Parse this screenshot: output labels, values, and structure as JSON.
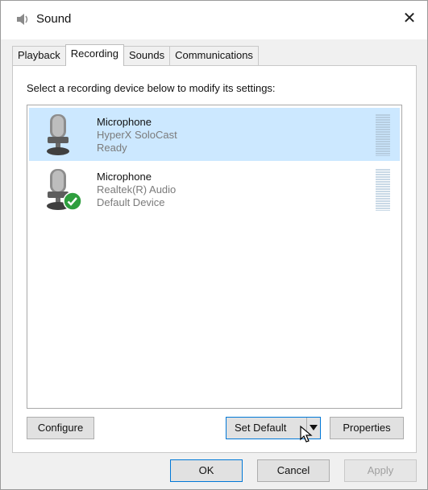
{
  "window": {
    "title": "Sound",
    "close_glyph": "✕"
  },
  "tabs": [
    {
      "label": "Playback",
      "active": false
    },
    {
      "label": "Recording",
      "active": true
    },
    {
      "label": "Sounds",
      "active": false
    },
    {
      "label": "Communications",
      "active": false
    }
  ],
  "recording": {
    "instruction": "Select a recording device below to modify its settings:",
    "devices": [
      {
        "name": "Microphone",
        "driver": "HyperX SoloCast",
        "status": "Ready",
        "selected": true,
        "is_default": false
      },
      {
        "name": "Microphone",
        "driver": "Realtek(R) Audio",
        "status": "Default Device",
        "selected": false,
        "is_default": true
      }
    ],
    "buttons": {
      "configure": "Configure",
      "set_default": "Set Default",
      "properties": "Properties"
    }
  },
  "dialog_buttons": {
    "ok": "OK",
    "cancel": "Cancel",
    "apply": "Apply"
  },
  "colors": {
    "selection": "#cce8ff",
    "focus": "#0078d7",
    "default_check": "#2e9e3e"
  },
  "icons": [
    "speaker-icon",
    "close-icon",
    "microphone-icon",
    "green-check-icon",
    "level-meter",
    "dropdown-arrow-icon",
    "mouse-cursor-icon"
  ]
}
